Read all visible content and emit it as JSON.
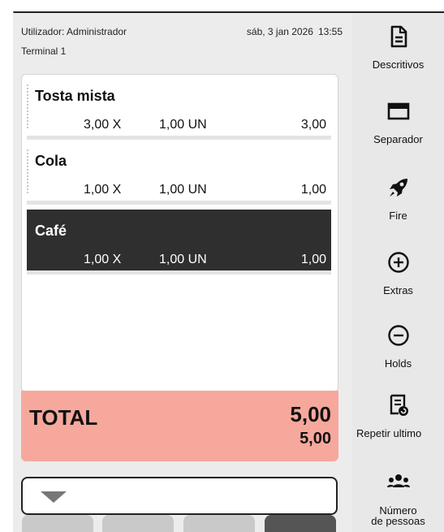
{
  "header": {
    "user": "Utilizador: Administrador",
    "terminal": "Terminal 1",
    "date": "sáb, 3 jan 2026",
    "time": "13:55"
  },
  "ticket": {
    "lines": [
      {
        "name": "Tosta mista",
        "qty": "3,00 X",
        "unit": "1,00 UN",
        "total": "3,00",
        "selected": false
      },
      {
        "name": "Cola",
        "qty": "1,00 X",
        "unit": "1,00 UN",
        "total": "1,00",
        "selected": false
      },
      {
        "name": "Café",
        "qty": "1,00 X",
        "unit": "1,00 UN",
        "total": "1,00",
        "selected": true
      }
    ]
  },
  "totals": {
    "label": "TOTAL",
    "main": "5,00",
    "sub": "5,00"
  },
  "sidebar": {
    "items": [
      {
        "label": "Descritivos",
        "icon": "document-icon"
      },
      {
        "label": "Separador",
        "icon": "window-icon"
      },
      {
        "label": "Fire",
        "icon": "rocket-icon"
      },
      {
        "label": "Extras",
        "icon": "plus-circle-icon"
      },
      {
        "label": "Holds",
        "icon": "minus-circle-icon"
      },
      {
        "label": "Repetir ultimo",
        "icon": "receipt-repeat-icon"
      },
      {
        "label": "Número de pessoas",
        "label_line1": "Número",
        "label_line2": "de pessoas",
        "icon": "people-icon"
      }
    ]
  },
  "colors": {
    "total_bg": "#f6a89c",
    "selected_bg": "#2f2f2f",
    "panel_bg": "#ececec"
  }
}
